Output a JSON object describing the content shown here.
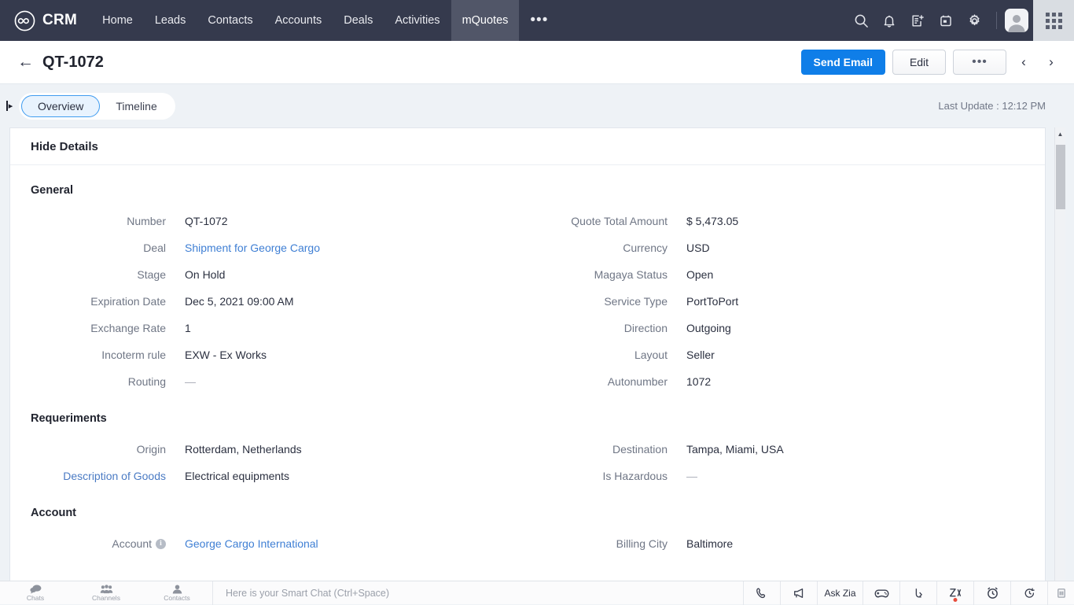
{
  "topnav": {
    "brand": "CRM",
    "brand_logo_icon": "infinity-circle-logo",
    "links": [
      {
        "label": "Home",
        "active": false
      },
      {
        "label": "Leads",
        "active": false
      },
      {
        "label": "Contacts",
        "active": false
      },
      {
        "label": "Accounts",
        "active": false
      },
      {
        "label": "Deals",
        "active": false
      },
      {
        "label": "Activities",
        "active": false
      },
      {
        "label": "mQuotes",
        "active": true
      }
    ],
    "more_label": "•••",
    "icons": [
      "search-icon",
      "bell-icon",
      "add-note-icon",
      "calendar-icon",
      "gear-icon"
    ],
    "avatar_icon": "user-avatar",
    "apps_icon": "app-grid-icon",
    "background_color": "#353a4d",
    "active_tab_color": "#515668"
  },
  "record_header": {
    "back_icon": "back-arrow-icon",
    "title": "QT-1072",
    "send_email_label": "Send Email",
    "edit_label": "Edit",
    "more_label": "•••",
    "prev_icon": "chevron-left-icon",
    "next_icon": "chevron-right-icon",
    "primary_color": "#0f7ee8"
  },
  "tabbar": {
    "sidebar_toggle_icon": "sidebar-expand-icon",
    "tabs": [
      {
        "label": "Overview",
        "active": true
      },
      {
        "label": "Timeline",
        "active": false
      }
    ],
    "last_update": "Last Update : 12:12 PM"
  },
  "card": {
    "hide_details_label": "Hide Details",
    "sections": [
      {
        "title": "General",
        "left": [
          {
            "label": "Number",
            "value": "QT-1072",
            "type": "text"
          },
          {
            "label": "Deal",
            "value": "Shipment for George Cargo",
            "type": "link"
          },
          {
            "label": "Stage",
            "value": "On Hold",
            "type": "text"
          },
          {
            "label": "Expiration Date",
            "value": "Dec 5, 2021 09:00 AM",
            "type": "text"
          },
          {
            "label": "Exchange Rate",
            "value": "1",
            "type": "text"
          },
          {
            "label": "Incoterm rule",
            "value": "EXW - Ex Works",
            "type": "text"
          },
          {
            "label": "Routing",
            "value": "—",
            "type": "empty"
          }
        ],
        "right": [
          {
            "label": "Quote Total Amount",
            "value": "$ 5,473.05",
            "type": "text"
          },
          {
            "label": "Currency",
            "value": "USD",
            "type": "text"
          },
          {
            "label": "Magaya Status",
            "value": "Open",
            "type": "text"
          },
          {
            "label": "Service Type",
            "value": "PortToPort",
            "type": "text"
          },
          {
            "label": "Direction",
            "value": "Outgoing",
            "type": "text"
          },
          {
            "label": "Layout",
            "value": "Seller",
            "type": "text"
          },
          {
            "label": "Autonumber",
            "value": "1072",
            "type": "text"
          }
        ]
      },
      {
        "title": "Requeriments",
        "left": [
          {
            "label": "Origin",
            "value": "Rotterdam, Netherlands",
            "type": "text"
          },
          {
            "label": "Description of Goods",
            "value": "Electrical equipments",
            "type": "text",
            "label_style": "linkish"
          }
        ],
        "right": [
          {
            "label": "Destination",
            "value": "Tampa, Miami, USA",
            "type": "text"
          },
          {
            "label": "Is Hazardous",
            "value": "—",
            "type": "empty"
          }
        ]
      },
      {
        "title": "Account",
        "left": [
          {
            "label": "Account",
            "value": "George Cargo International",
            "type": "link",
            "info_icon": "info-icon"
          }
        ],
        "right": [
          {
            "label": "Billing City",
            "value": "Baltimore",
            "type": "text"
          }
        ]
      }
    ]
  },
  "scrollbar": {
    "up_arrow_icon": "scroll-up-arrow-icon",
    "thumb_name": "scroll-thumb"
  },
  "bottombar": {
    "tiles": [
      {
        "label": "Chats",
        "icon": "chat-bubble-icon"
      },
      {
        "label": "Channels",
        "icon": "channels-group-icon"
      },
      {
        "label": "Contacts",
        "icon": "contact-person-icon"
      }
    ],
    "chat_placeholder": "Here is your Smart Chat (Ctrl+Space)",
    "right_icons": [
      {
        "name": "phone-icon",
        "label": ""
      },
      {
        "name": "megaphone-icon",
        "label": ""
      },
      {
        "name": "ask-zia-button",
        "label": "Ask Zia"
      },
      {
        "name": "gamepad-icon",
        "label": ""
      },
      {
        "name": "share-arrow-icon",
        "label": ""
      },
      {
        "name": "zia-notification-icon",
        "label": ""
      },
      {
        "name": "alarm-clock-icon",
        "label": ""
      },
      {
        "name": "history-icon",
        "label": ""
      },
      {
        "name": "trash-icon",
        "label": ""
      }
    ]
  }
}
